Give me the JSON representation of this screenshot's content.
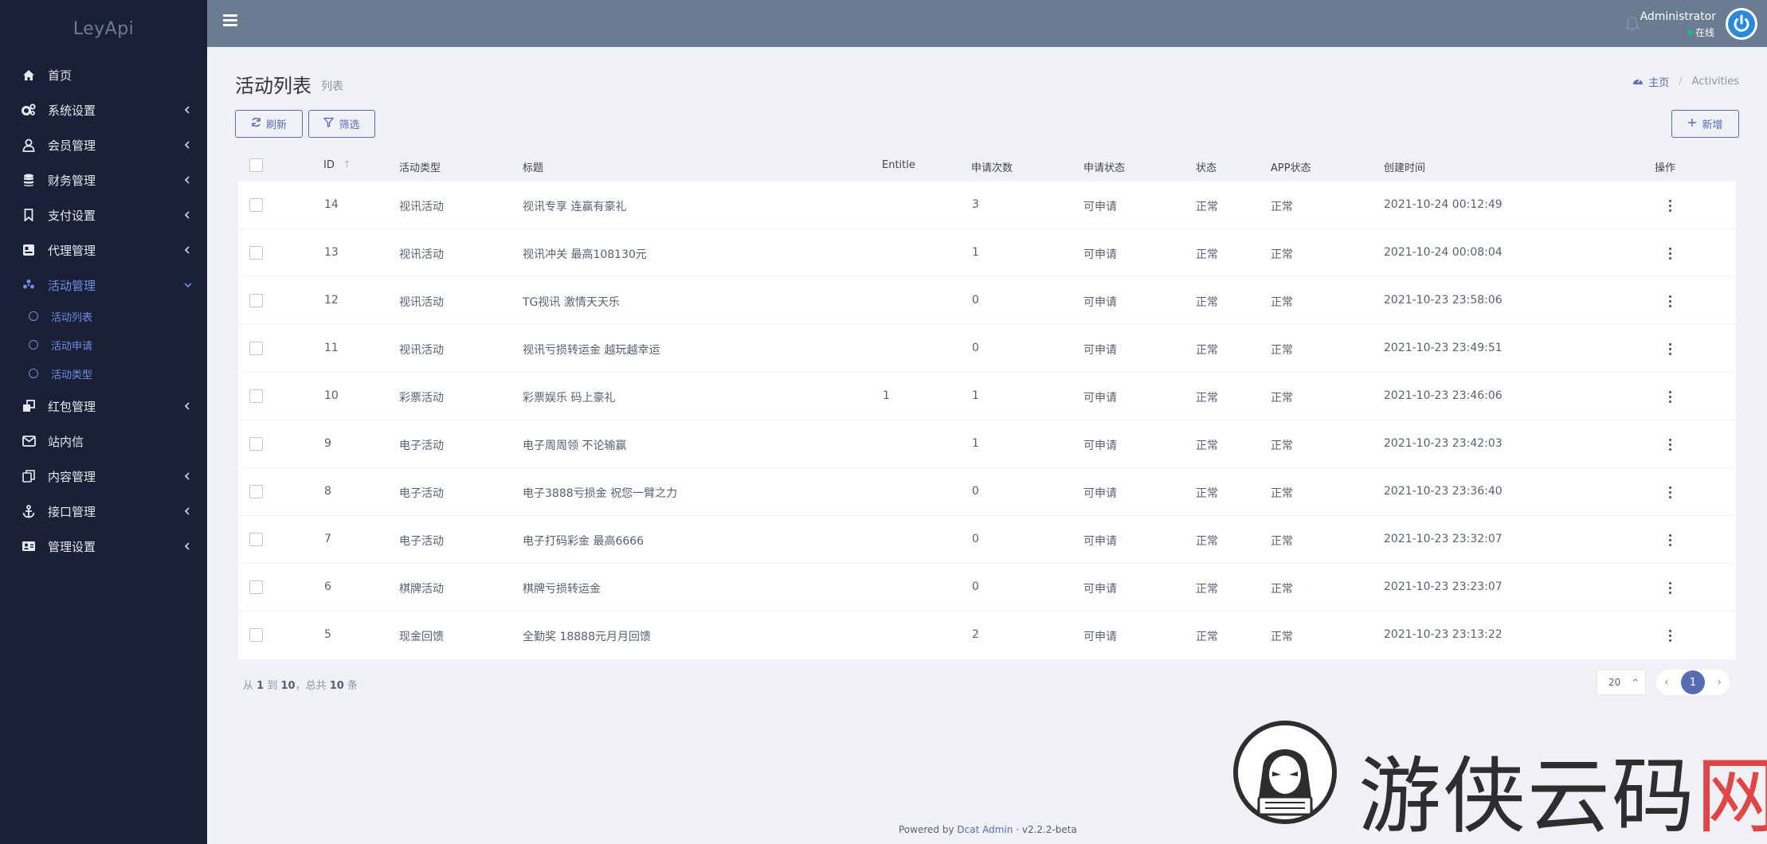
{
  "app": {
    "brand": "LeyApi"
  },
  "sidebar": {
    "items": [
      {
        "label": "首页",
        "icon": "home-icon",
        "has_children": false
      },
      {
        "label": "系统设置",
        "icon": "cogs-icon",
        "has_children": true
      },
      {
        "label": "会员管理",
        "icon": "user-icon",
        "has_children": true
      },
      {
        "label": "财务管理",
        "icon": "database-icon",
        "has_children": true
      },
      {
        "label": "支付设置",
        "icon": "bookmark-icon",
        "has_children": true
      },
      {
        "label": "代理管理",
        "icon": "id-card-icon",
        "has_children": true
      },
      {
        "label": "活动管理",
        "icon": "pinwheel-icon",
        "has_children": true,
        "expanded": true
      },
      {
        "label": "红包管理",
        "icon": "clone-icon",
        "has_children": true
      },
      {
        "label": "站内信",
        "icon": "envelope-icon",
        "has_children": false
      },
      {
        "label": "内容管理",
        "icon": "copy-icon",
        "has_children": true
      },
      {
        "label": "接口管理",
        "icon": "anchor-icon",
        "has_children": true
      },
      {
        "label": "管理设置",
        "icon": "address-card-icon",
        "has_children": true
      }
    ],
    "sub_items": [
      "活动列表",
      "活动申请",
      "活动类型"
    ]
  },
  "topbar": {
    "user_name": "Administrator",
    "user_status": "在线"
  },
  "header": {
    "title": "活动列表",
    "subtitle": "列表",
    "breadcrumb_home": "主页",
    "breadcrumb_current": "Activities"
  },
  "toolbar": {
    "refresh_label": "刷新",
    "filter_label": "筛选",
    "create_label": "新增"
  },
  "table": {
    "columns": [
      "ID",
      "活动类型",
      "标题",
      "Entitle",
      "申请次数",
      "申请状态",
      "状态",
      "APP状态",
      "创建时间",
      "操作"
    ],
    "rows": [
      {
        "id": "14",
        "type": "视讯活动",
        "title": "视讯专享 连赢有豪礼",
        "entitle": "",
        "count": "3",
        "apply_status": "可申请",
        "status": "正常",
        "app_status": "正常",
        "created": "2021-10-24 00:12:49"
      },
      {
        "id": "13",
        "type": "视讯活动",
        "title": "视讯冲关 最高108130元",
        "entitle": "",
        "count": "1",
        "apply_status": "可申请",
        "status": "正常",
        "app_status": "正常",
        "created": "2021-10-24 00:08:04"
      },
      {
        "id": "12",
        "type": "视讯活动",
        "title": "TG视讯 激情天天乐",
        "entitle": "",
        "count": "0",
        "apply_status": "可申请",
        "status": "正常",
        "app_status": "正常",
        "created": "2021-10-23 23:58:06"
      },
      {
        "id": "11",
        "type": "视讯活动",
        "title": "视讯亏损转运金 越玩越幸运",
        "entitle": "",
        "count": "0",
        "apply_status": "可申请",
        "status": "正常",
        "app_status": "正常",
        "created": "2021-10-23 23:49:51"
      },
      {
        "id": "10",
        "type": "彩票活动",
        "title": "彩票娱乐 码上豪礼",
        "entitle": "1",
        "count": "1",
        "apply_status": "可申请",
        "status": "正常",
        "app_status": "正常",
        "created": "2021-10-23 23:46:06"
      },
      {
        "id": "9",
        "type": "电子活动",
        "title": "电子周周领 不论输赢",
        "entitle": "",
        "count": "1",
        "apply_status": "可申请",
        "status": "正常",
        "app_status": "正常",
        "created": "2021-10-23 23:42:03"
      },
      {
        "id": "8",
        "type": "电子活动",
        "title": "电子3888亏损金 祝您一臂之力",
        "entitle": "",
        "count": "0",
        "apply_status": "可申请",
        "status": "正常",
        "app_status": "正常",
        "created": "2021-10-23 23:36:40"
      },
      {
        "id": "7",
        "type": "电子活动",
        "title": "电子打码彩金 最高6666",
        "entitle": "",
        "count": "0",
        "apply_status": "可申请",
        "status": "正常",
        "app_status": "正常",
        "created": "2021-10-23 23:32:07"
      },
      {
        "id": "6",
        "type": "棋牌活动",
        "title": "棋牌亏损转运金",
        "entitle": "",
        "count": "0",
        "apply_status": "可申请",
        "status": "正常",
        "app_status": "正常",
        "created": "2021-10-23 23:23:07"
      },
      {
        "id": "5",
        "type": "现金回馈",
        "title": "全勤奖 18888元月月回馈",
        "entitle": "",
        "count": "2",
        "apply_status": "可申请",
        "status": "正常",
        "app_status": "正常",
        "created": "2021-10-23 23:13:22"
      }
    ]
  },
  "pagination": {
    "summary_prefix": "从",
    "from": "1",
    "to_word": "到",
    "to": "10",
    "total_word": "，总共",
    "total": "10",
    "suffix": "条",
    "per_page": "20",
    "current_page": "1"
  },
  "footer": {
    "powered_prefix": "Powered by",
    "powered_link": "Dcat Admin",
    "separator": "·",
    "version": "v2.2.2-beta"
  },
  "watermark": {
    "text_main": "游侠云码",
    "text_accent": "网"
  },
  "colors": {
    "sidebar_bg": "#1a2035",
    "topbar_bg": "#6b7b92",
    "accent": "#586cb1",
    "page_bg": "#eff1f6"
  }
}
